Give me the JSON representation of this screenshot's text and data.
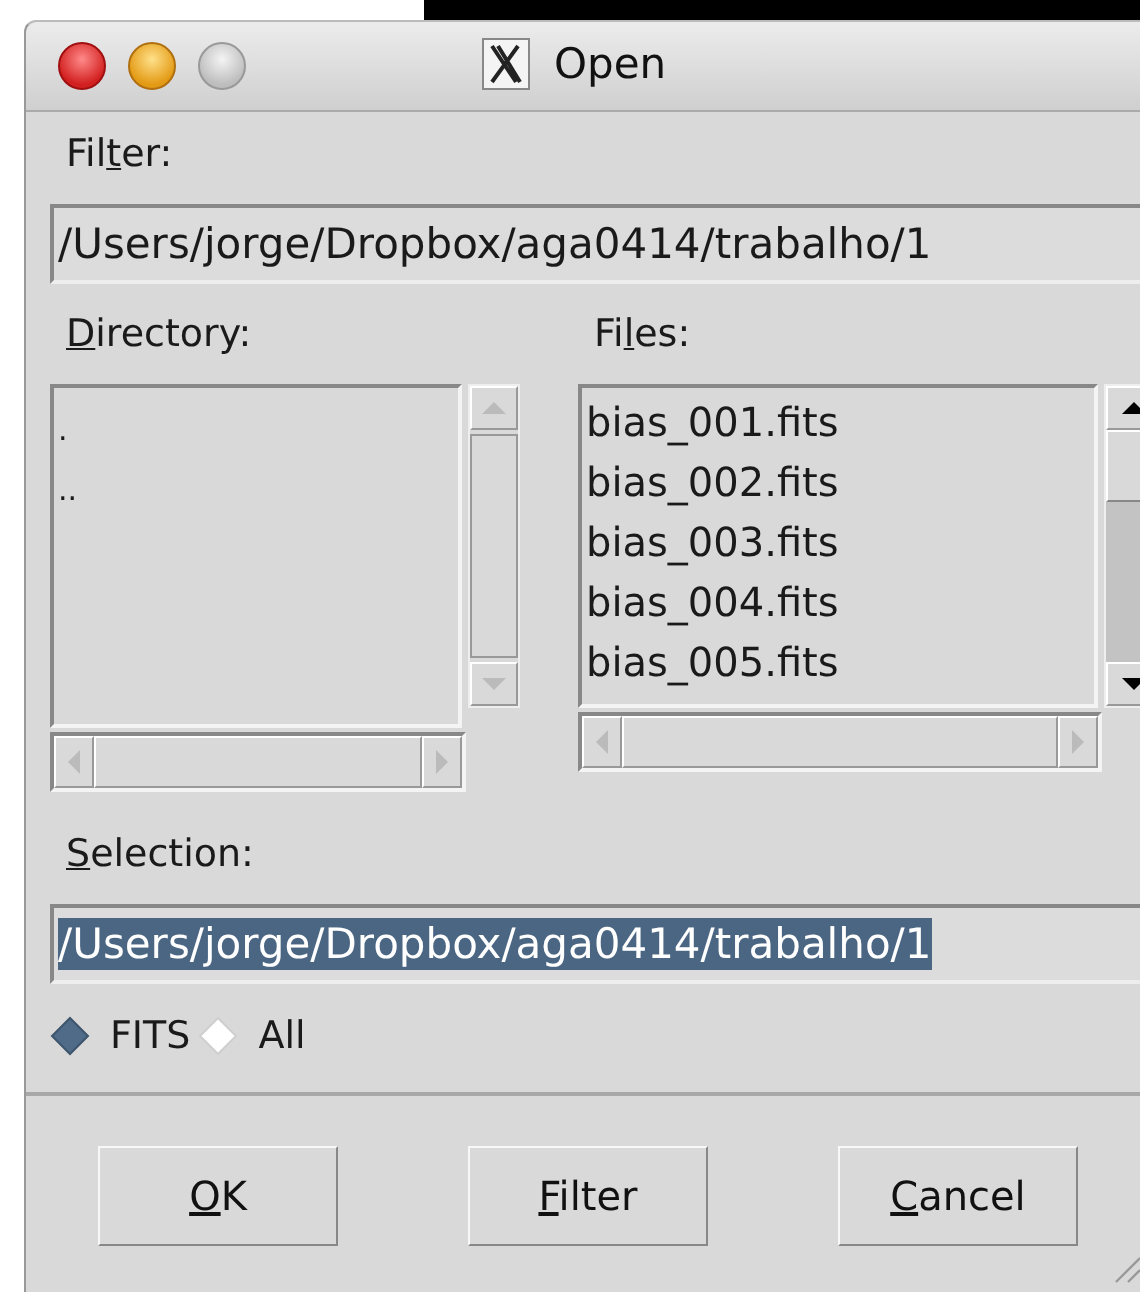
{
  "window": {
    "title": "Open"
  },
  "filter": {
    "label": {
      "pre": "Fil",
      "key": "t",
      "post": "er:"
    },
    "value": "/Users/jorge/Dropbox/aga0414/trabalho/1"
  },
  "directory": {
    "label": {
      "key": "D",
      "post": "irectory:"
    },
    "items": [
      ".",
      ".."
    ]
  },
  "files": {
    "label": {
      "pre": "Fi",
      "key": "l",
      "post": "es:"
    },
    "items": [
      "bias_001.fits",
      "bias_002.fits",
      "bias_003.fits",
      "bias_004.fits",
      "bias_005.fits"
    ]
  },
  "selection": {
    "label": {
      "key": "S",
      "post": "election:"
    },
    "value": "/Users/jorge/Dropbox/aga0414/trabalho/1",
    "highlighted": true
  },
  "file_types": [
    {
      "label": "FITS",
      "selected": true
    },
    {
      "label": "All",
      "selected": false
    }
  ],
  "buttons": [
    {
      "key": "O",
      "post": "K"
    },
    {
      "key": "F",
      "post": "ilter"
    },
    {
      "key": "C",
      "post": "ancel"
    }
  ]
}
